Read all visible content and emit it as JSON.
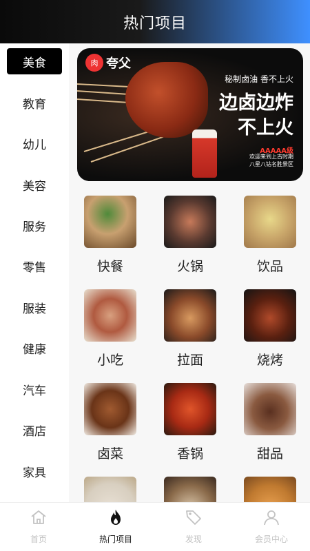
{
  "header": {
    "title": "热门项目"
  },
  "sidebar": {
    "items": [
      {
        "label": "美食",
        "active": true
      },
      {
        "label": "教育"
      },
      {
        "label": "幼儿"
      },
      {
        "label": "美容"
      },
      {
        "label": "服务"
      },
      {
        "label": "零售"
      },
      {
        "label": "服装"
      },
      {
        "label": "健康"
      },
      {
        "label": "汽车"
      },
      {
        "label": "酒店"
      },
      {
        "label": "家具"
      }
    ]
  },
  "banner": {
    "brand": "夸父",
    "brand_badge": "肉",
    "tagline": "秘制卤油 香不上火",
    "slogan_line1": "边卤边炸",
    "slogan_line2": "不上火",
    "stars": "AAAAA级",
    "small_line1": "欢迎来到上古时期",
    "small_line2": "八星八钻名胜景区"
  },
  "categories": [
    {
      "label": "快餐"
    },
    {
      "label": "火锅"
    },
    {
      "label": "饮品"
    },
    {
      "label": "小吃"
    },
    {
      "label": "拉面"
    },
    {
      "label": "烧烤"
    },
    {
      "label": "卤菜"
    },
    {
      "label": "香锅"
    },
    {
      "label": "甜品"
    }
  ],
  "tabbar": {
    "items": [
      {
        "label": "首页",
        "icon": "home-icon"
      },
      {
        "label": "热门项目",
        "icon": "fire-icon",
        "active": true
      },
      {
        "label": "发现",
        "icon": "tag-icon"
      },
      {
        "label": "会员中心",
        "icon": "user-icon"
      }
    ]
  }
}
